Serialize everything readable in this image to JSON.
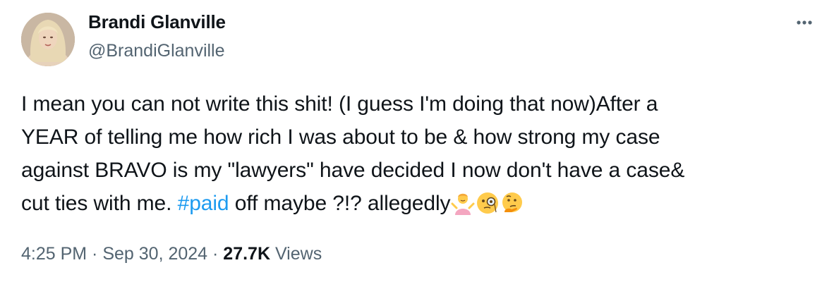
{
  "author": {
    "display_name": "Brandi Glanville",
    "handle": "@BrandiGlanville",
    "avatar_icon": "profile-photo"
  },
  "more_icon": "more-options-icon",
  "tweet": {
    "lines": [
      "I mean you can not write this shit! (I guess I'm doing that now)After a",
      "YEAR of telling me how rich I was about to be & how strong my case",
      "against BRAVO is my \"lawyers\" have decided I now don't have a case&"
    ],
    "last_line_prefix": "cut ties with me. ",
    "hashtag": "#paid",
    "last_line_suffix": " off maybe ?!? allegedly",
    "emojis": [
      "person-shrugging-emoji",
      "face-with-monocle-emoji",
      "thinking-face-emoji"
    ]
  },
  "meta": {
    "time": "4:25 PM",
    "separator": " · ",
    "date": "Sep 30, 2024",
    "views_count": "27.7K",
    "views_label": " Views"
  },
  "colors": {
    "text": "#0f1419",
    "secondary": "#536471",
    "link": "#1d9bf0"
  }
}
